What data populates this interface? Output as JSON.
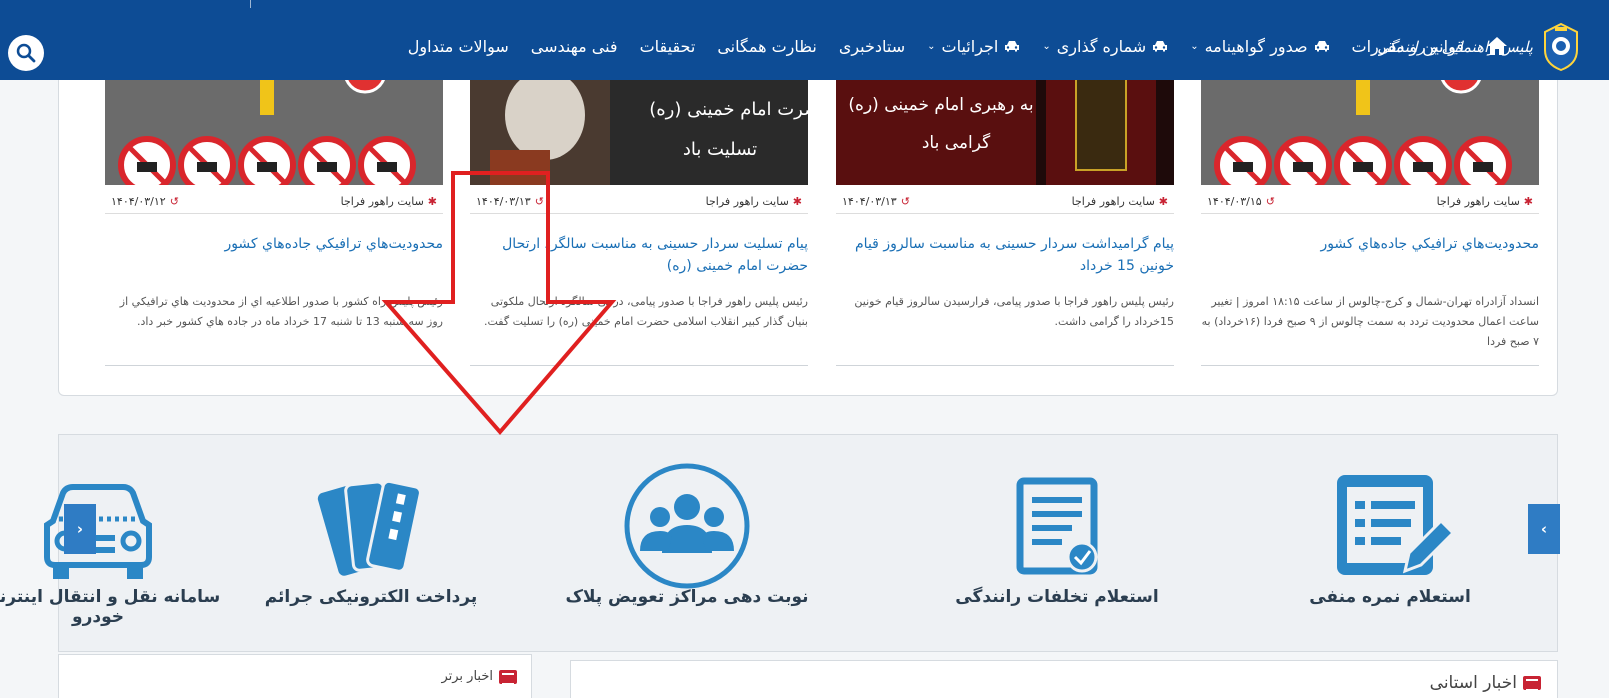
{
  "navbar": {
    "logo_text": "پلیس راهنمایی و رانندگی",
    "items": [
      {
        "label": "قوانین و مقررات",
        "has_car": false,
        "has_dropdown": false
      },
      {
        "label": "صدور گواهینامه",
        "has_car": true,
        "has_dropdown": true
      },
      {
        "label": "شماره گذاری",
        "has_car": true,
        "has_dropdown": true
      },
      {
        "label": "اجرائیات",
        "has_car": true,
        "has_dropdown": true
      },
      {
        "label": "ستادخبری",
        "has_car": false,
        "has_dropdown": false
      },
      {
        "label": "نظارت همگانی",
        "has_car": false,
        "has_dropdown": false
      },
      {
        "label": "تحقیقات",
        "has_car": false,
        "has_dropdown": false
      },
      {
        "label": "فنی مهندسی",
        "has_car": false,
        "has_dropdown": false
      },
      {
        "label": "سوالات متداول",
        "has_car": false,
        "has_dropdown": false
      }
    ],
    "home_icon": "home-icon",
    "search_icon": "search-icon"
  },
  "news": [
    {
      "source": "سایت راهور فراجا",
      "date": "۱۴۰۴/۰۳/۱۵",
      "title": "محدوديت‌هاي ترافيكي جاده‌هاي کشور",
      "body": "انسداد آزادراه تهران-شمال و کرج-چالوس از ساعت ۱۸:۱۵ امروز | تغییر ساعت اعمال محدودیت تردد به سمت چالوس از ۹ صبح فردا (۱۶خرداد) به ۷ صبح فردا"
    },
    {
      "source": "سایت راهور فراجا",
      "date": "۱۴۰۴/۰۳/۱۳",
      "title": "پیام گرامیداشت سردار حسینی به مناسبت سالروز قیام خونین 15 خرداد",
      "body": "رئیس پلیس راهور فراجا با صدور پیامی، فرارسیدن سالروز قیام خونین 15خرداد را گرامی داشت."
    },
    {
      "source": "سایت راهور فراجا",
      "date": "۱۴۰۴/۰۳/۱۳",
      "title": "پیام تسلیت سردار حسینی به مناسبت سالگرد ارتحال حضرت امام خمینی (ره)",
      "body": "رئیس پلیس راهور فراجا با صدور پیامی، در پی سالگرد ارتحال ملکوتی بنیان گذار کبیر انقلاب اسلامی حضرت امام خمینی (ره) را تسلیت گفت."
    },
    {
      "source": "سایت راهور فراجا",
      "date": "۱۴۰۴/۰۳/۱۲",
      "title": "محدوديت‌هاي ترافيكي جاده‌هاي کشور",
      "body": "رئیس پلیس راه کشور با صدور اطلاعيه اي از محدوديت هاي ترافيكي از روز سه شنبه 13 تا شنبه 17 خرداد ماه در جاده هاي کشور خبر داد."
    }
  ],
  "image_captions": {
    "imam_banner_line1": "حضرت امام خمینی (ره)",
    "imam_banner_line2": "تسلیت باد",
    "leader_banner_line1": "به رهبری امام خمینی (ره)",
    "leader_banner_line2": "گرامی باد"
  },
  "services": [
    {
      "label": "استعلام نمره منفی",
      "icon": "form-edit-icon"
    },
    {
      "label": "استعلام تخلفات رانندگی",
      "icon": "document-check-icon"
    },
    {
      "label": "نوبت دهی مراکز تعویض پلاک",
      "icon": "users-group-icon"
    },
    {
      "label": "پرداخت الکترونیکی جرائم",
      "icon": "cards-icon"
    },
    {
      "label": "سامانه نقل و انتقال اینترنتی خودرو",
      "icon": "car-icon"
    }
  ],
  "carousel": {
    "prev": "›",
    "next": "‹"
  },
  "boxes": {
    "top_news_title": "اخبار برتر",
    "provincial_news_title": "اخبار استانی"
  },
  "colors": {
    "navbar": "#0d4c95",
    "link": "#1a6fb5",
    "icon_blue": "#2b87c6",
    "annotation_arrow": "#e02020"
  }
}
